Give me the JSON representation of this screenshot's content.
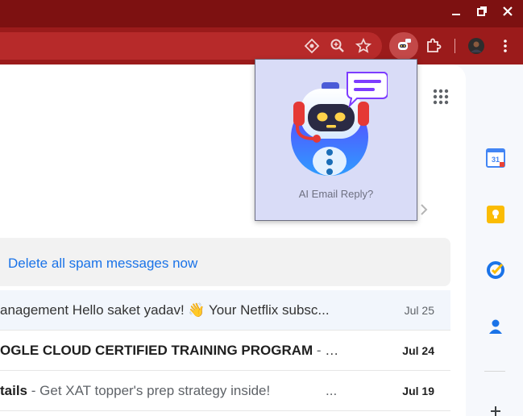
{
  "window": {
    "controls": [
      "minimize-icon",
      "restore-icon",
      "close-icon"
    ],
    "titlebar_color": "#7d1111"
  },
  "toolbar": {
    "icons": [
      "reader-mode-icon",
      "zoom-icon",
      "bookmark-star-icon",
      "ai-email-extension-icon",
      "extensions-puzzle-icon",
      "profile-avatar",
      "menu-kebab-icon"
    ],
    "color": "#9b1b1b"
  },
  "popup": {
    "caption": "AI Email Reply?"
  },
  "inbox": {
    "spam_action": "Delete all spam messages now",
    "rows": [
      {
        "sender": "",
        "subject": "anagement Hello saket yadav! 👋 Your Netflix subsc...",
        "date": "Jul 25",
        "unread": false
      },
      {
        "sender": "",
        "subject": "OGLE CLOUD CERTIFIED TRAINING PROGRAM",
        "snippet": " - D...",
        "date": "Jul 24",
        "unread": true
      },
      {
        "sender": "",
        "subject": "tails",
        "snippet": " - Get XAT topper's prep strategy inside!",
        "trail": "...",
        "date": "Jul 19",
        "unread": true
      }
    ]
  },
  "side_panel": {
    "apps": [
      "google-calendar-icon",
      "google-keep-icon",
      "google-tasks-icon",
      "google-contacts-icon",
      "add-icon"
    ],
    "calendar_day": "31"
  },
  "colors": {
    "link": "#1a73e8",
    "popup_bg": "#d9dcf7"
  }
}
